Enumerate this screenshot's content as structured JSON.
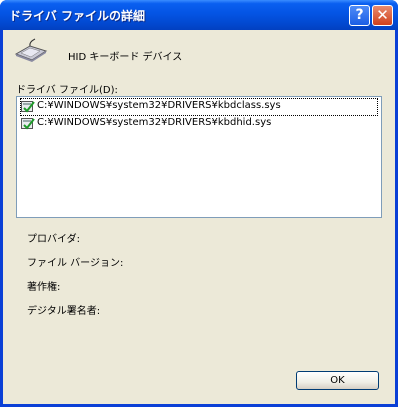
{
  "window": {
    "title": "ドライバ ファイルの詳細",
    "help_label": "?",
    "close_label": "✕"
  },
  "device": {
    "name": "HID キーボード デバイス",
    "icon": "keyboard-icon"
  },
  "files": {
    "label": "ドライバ ファイル(D):",
    "items": [
      {
        "path": "C:¥WINDOWS¥system32¥DRIVERS¥kbdclass.sys",
        "icon": "signed-driver-icon"
      },
      {
        "path": "C:¥WINDOWS¥system32¥DRIVERS¥kbdhid.sys",
        "icon": "signed-driver-icon"
      }
    ]
  },
  "details": {
    "provider": "プロバイダ:",
    "version": "ファイル バージョン:",
    "copyright": "著作権:",
    "signer": "デジタル署名者:"
  },
  "buttons": {
    "ok": "OK"
  },
  "colors": {
    "titlebar": "#0454e4",
    "client": "#ece9d8",
    "list_border": "#7f9db9"
  }
}
